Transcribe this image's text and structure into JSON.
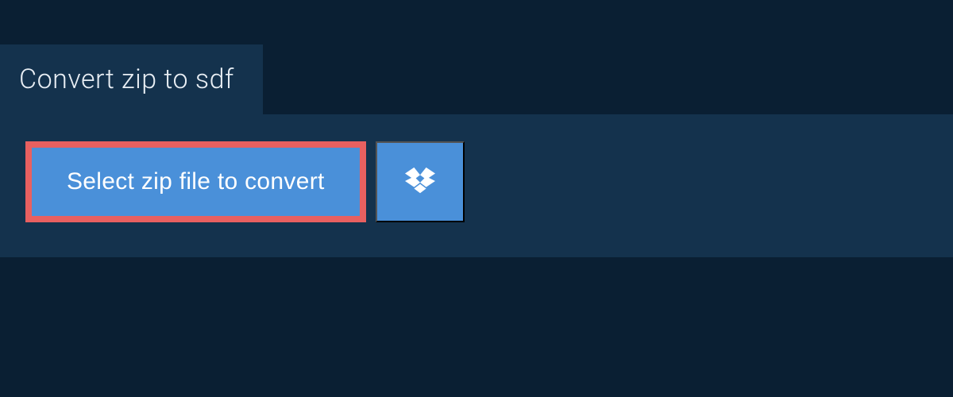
{
  "tab": {
    "title": "Convert zip to sdf"
  },
  "actions": {
    "select_file_label": "Select zip file to convert"
  },
  "colors": {
    "bg_dark": "#0a1f33",
    "bg_panel": "#14324d",
    "button_primary": "#4a90d9",
    "highlight_border": "#e86060",
    "text_light": "#e8eef4"
  }
}
